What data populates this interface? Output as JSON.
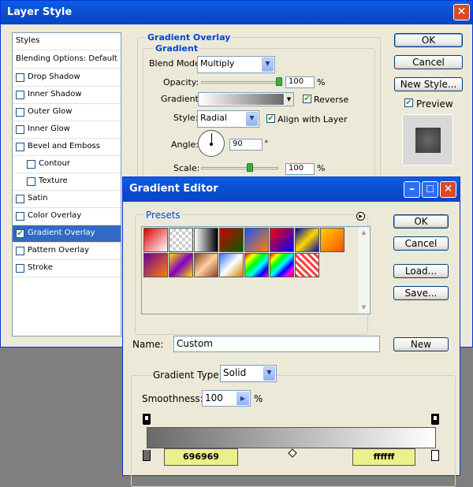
{
  "layer_style": {
    "title": "Layer Style",
    "styles_header": "Styles",
    "blending_options": "Blending Options: Default",
    "effects": [
      {
        "label": "Drop Shadow",
        "checked": false
      },
      {
        "label": "Inner Shadow",
        "checked": false
      },
      {
        "label": "Outer Glow",
        "checked": false
      },
      {
        "label": "Inner Glow",
        "checked": false
      },
      {
        "label": "Bevel and Emboss",
        "checked": false
      },
      {
        "label": "Contour",
        "checked": false
      },
      {
        "label": "Texture",
        "checked": false
      },
      {
        "label": "Satin",
        "checked": false
      },
      {
        "label": "Color Overlay",
        "checked": false
      },
      {
        "label": "Gradient Overlay",
        "checked": true
      },
      {
        "label": "Pattern Overlay",
        "checked": false
      },
      {
        "label": "Stroke",
        "checked": false
      }
    ],
    "section_title": "Gradient Overlay",
    "subsection_title": "Gradient",
    "blend_mode_label": "Blend Mode:",
    "blend_mode_value": "Multiply",
    "opacity_label": "Opacity:",
    "opacity_value": "100",
    "opacity_unit": "%",
    "gradient_label": "Gradient:",
    "reverse_label": "Reverse",
    "reverse_checked": true,
    "style_label": "Style:",
    "style_value": "Radial",
    "align_label": "Align with Layer",
    "align_checked": true,
    "angle_label": "Angle:",
    "angle_value": "90",
    "angle_unit": "°",
    "scale_label": "Scale:",
    "scale_value": "100",
    "scale_unit": "%",
    "ok_label": "OK",
    "cancel_label": "Cancel",
    "new_style_label": "New Style...",
    "preview_label": "Preview",
    "preview_checked": true
  },
  "gradient_editor": {
    "title": "Gradient Editor",
    "presets_label": "Presets",
    "ok_label": "OK",
    "cancel_label": "Cancel",
    "load_label": "Load...",
    "save_label": "Save...",
    "name_label": "Name:",
    "name_value": "Custom",
    "new_label": "New",
    "gradient_type_label": "Gradient Type:",
    "gradient_type_value": "Solid",
    "smoothness_label": "Smoothness:",
    "smoothness_value": "100",
    "smoothness_unit": "%",
    "color_stop_left": "696969",
    "color_stop_right": "ffffff",
    "preset_swatches": [
      "linear-gradient(135deg,#e00000,#fff)",
      "repeating-conic-gradient(#ccc 0 25%,#fff 0 50%) 0 0/8px 8px",
      "linear-gradient(90deg,#fff,#000)",
      "linear-gradient(135deg,#d00000,#006000)",
      "linear-gradient(135deg,#2050ff,#ff8000)",
      "linear-gradient(135deg,#ff0000,#0000ff)",
      "linear-gradient(135deg,#0000b0,#ffd800,#0000b0)",
      "linear-gradient(135deg,#ffd000,#ff5000)",
      "linear-gradient(135deg,#6a00a0,#ff8000)",
      "linear-gradient(135deg,#ffe000,#8000c0,#ffe000)",
      "linear-gradient(135deg,#8a4020,#ffd0a0,#8a4020)",
      "linear-gradient(135deg,#3070ff,#fff 50%,#d08000)",
      "linear-gradient(135deg,#ff0000,#ff0,#0f0,#0ff,#00f,#f0f)",
      "linear-gradient(135deg,#f00,#ff0,#0f0,#0ff,#00f,#f0f,#f00)",
      "repeating-linear-gradient(45deg,#ff4040 0 3px,#fff 3px 6px)"
    ]
  }
}
